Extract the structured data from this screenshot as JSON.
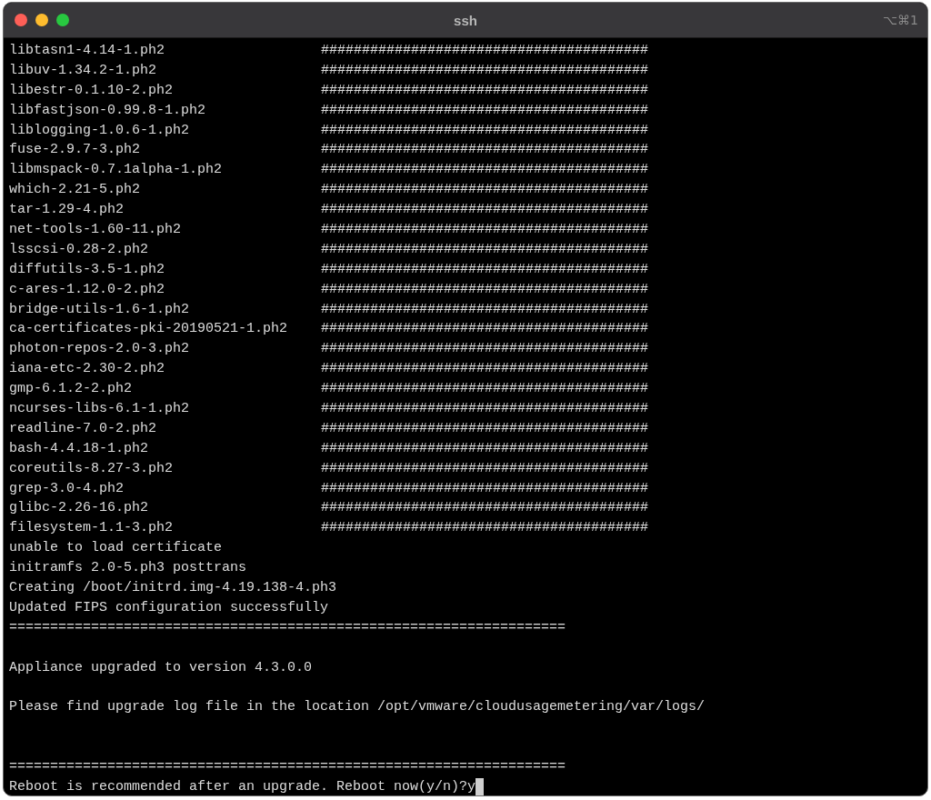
{
  "window": {
    "title": "ssh",
    "shortcut": "⌥⌘1"
  },
  "lines": [
    {
      "kind": "package",
      "name": "libtasn1-4.14-1.ph2",
      "progress": "########################################"
    },
    {
      "kind": "package",
      "name": "libuv-1.34.2-1.ph2",
      "progress": "########################################"
    },
    {
      "kind": "package",
      "name": "libestr-0.1.10-2.ph2",
      "progress": "########################################"
    },
    {
      "kind": "package",
      "name": "libfastjson-0.99.8-1.ph2",
      "progress": "########################################"
    },
    {
      "kind": "package",
      "name": "liblogging-1.0.6-1.ph2",
      "progress": "########################################"
    },
    {
      "kind": "package",
      "name": "fuse-2.9.7-3.ph2",
      "progress": "########################################"
    },
    {
      "kind": "package",
      "name": "libmspack-0.7.1alpha-1.ph2",
      "progress": "########################################"
    },
    {
      "kind": "package",
      "name": "which-2.21-5.ph2",
      "progress": "########################################"
    },
    {
      "kind": "package",
      "name": "tar-1.29-4.ph2",
      "progress": "########################################"
    },
    {
      "kind": "package",
      "name": "net-tools-1.60-11.ph2",
      "progress": "########################################"
    },
    {
      "kind": "package",
      "name": "lsscsi-0.28-2.ph2",
      "progress": "########################################"
    },
    {
      "kind": "package",
      "name": "diffutils-3.5-1.ph2",
      "progress": "########################################"
    },
    {
      "kind": "package",
      "name": "c-ares-1.12.0-2.ph2",
      "progress": "########################################"
    },
    {
      "kind": "package",
      "name": "bridge-utils-1.6-1.ph2",
      "progress": "########################################"
    },
    {
      "kind": "package",
      "name": "ca-certificates-pki-20190521-1.ph2",
      "progress": "########################################"
    },
    {
      "kind": "package",
      "name": "photon-repos-2.0-3.ph2",
      "progress": "########################################"
    },
    {
      "kind": "package",
      "name": "iana-etc-2.30-2.ph2",
      "progress": "########################################"
    },
    {
      "kind": "package",
      "name": "gmp-6.1.2-2.ph2",
      "progress": "########################################"
    },
    {
      "kind": "package",
      "name": "ncurses-libs-6.1-1.ph2",
      "progress": "########################################"
    },
    {
      "kind": "package",
      "name": "readline-7.0-2.ph2",
      "progress": "########################################"
    },
    {
      "kind": "package",
      "name": "bash-4.4.18-1.ph2",
      "progress": "########################################"
    },
    {
      "kind": "package",
      "name": "coreutils-8.27-3.ph2",
      "progress": "########################################"
    },
    {
      "kind": "package",
      "name": "grep-3.0-4.ph2",
      "progress": "########################################"
    },
    {
      "kind": "package",
      "name": "glibc-2.26-16.ph2",
      "progress": "########################################"
    },
    {
      "kind": "package",
      "name": "filesystem-1.1-3.ph2",
      "progress": "########################################"
    },
    {
      "kind": "text",
      "text": "unable to load certificate"
    },
    {
      "kind": "text",
      "text": "initramfs 2.0-5.ph3 posttrans"
    },
    {
      "kind": "text",
      "text": "Creating /boot/initrd.img-4.19.138-4.ph3"
    },
    {
      "kind": "text",
      "text": "Updated FIPS configuration successfully"
    },
    {
      "kind": "text",
      "text": "===================================================================="
    },
    {
      "kind": "blank"
    },
    {
      "kind": "text",
      "text": "Appliance upgraded to version 4.3.0.0"
    },
    {
      "kind": "blank"
    },
    {
      "kind": "text",
      "text": "Please find upgrade log file in the location /opt/vmware/cloudusagemetering/var/logs/"
    },
    {
      "kind": "blank"
    },
    {
      "kind": "blank"
    },
    {
      "kind": "text",
      "text": "===================================================================="
    },
    {
      "kind": "prompt",
      "text": "Reboot is recommended after an upgrade. Reboot now(y/n)?y"
    }
  ]
}
